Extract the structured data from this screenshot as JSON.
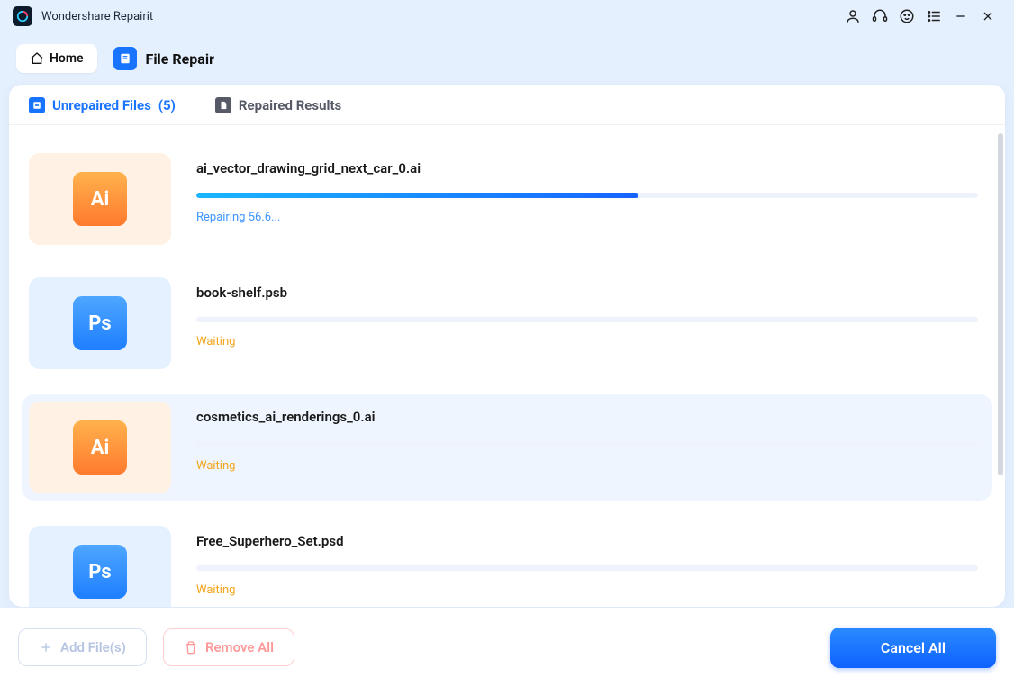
{
  "app": {
    "name": "Wondershare Repairit"
  },
  "nav": {
    "home_label": "Home",
    "module_title": "File Repair"
  },
  "tabs": {
    "unrepaired": {
      "label": "Unrepaired Files",
      "count": "(5)"
    },
    "repaired": {
      "label": "Repaired Results"
    }
  },
  "files": [
    {
      "name": "ai_vector_drawing_grid_next_car_0.ai",
      "type": "ai",
      "status_text": "Repairing 56.6...",
      "status": "repairing",
      "progress": 56.6
    },
    {
      "name": "book-shelf.psb",
      "type": "ps",
      "status_text": "Waiting",
      "status": "waiting",
      "progress": 0
    },
    {
      "name": "cosmetics_ai_renderings_0.ai",
      "type": "ai",
      "status_text": "Waiting",
      "status": "waiting",
      "progress": 0,
      "hovered": true
    },
    {
      "name": "Free_Superhero_Set.psd",
      "type": "ps",
      "status_text": "Waiting",
      "status": "waiting",
      "progress": 0
    }
  ],
  "thumb_labels": {
    "ai": "Ai",
    "ps": "Ps"
  },
  "footer": {
    "add_label": "Add File(s)",
    "remove_label": "Remove All",
    "cancel_label": "Cancel All"
  }
}
